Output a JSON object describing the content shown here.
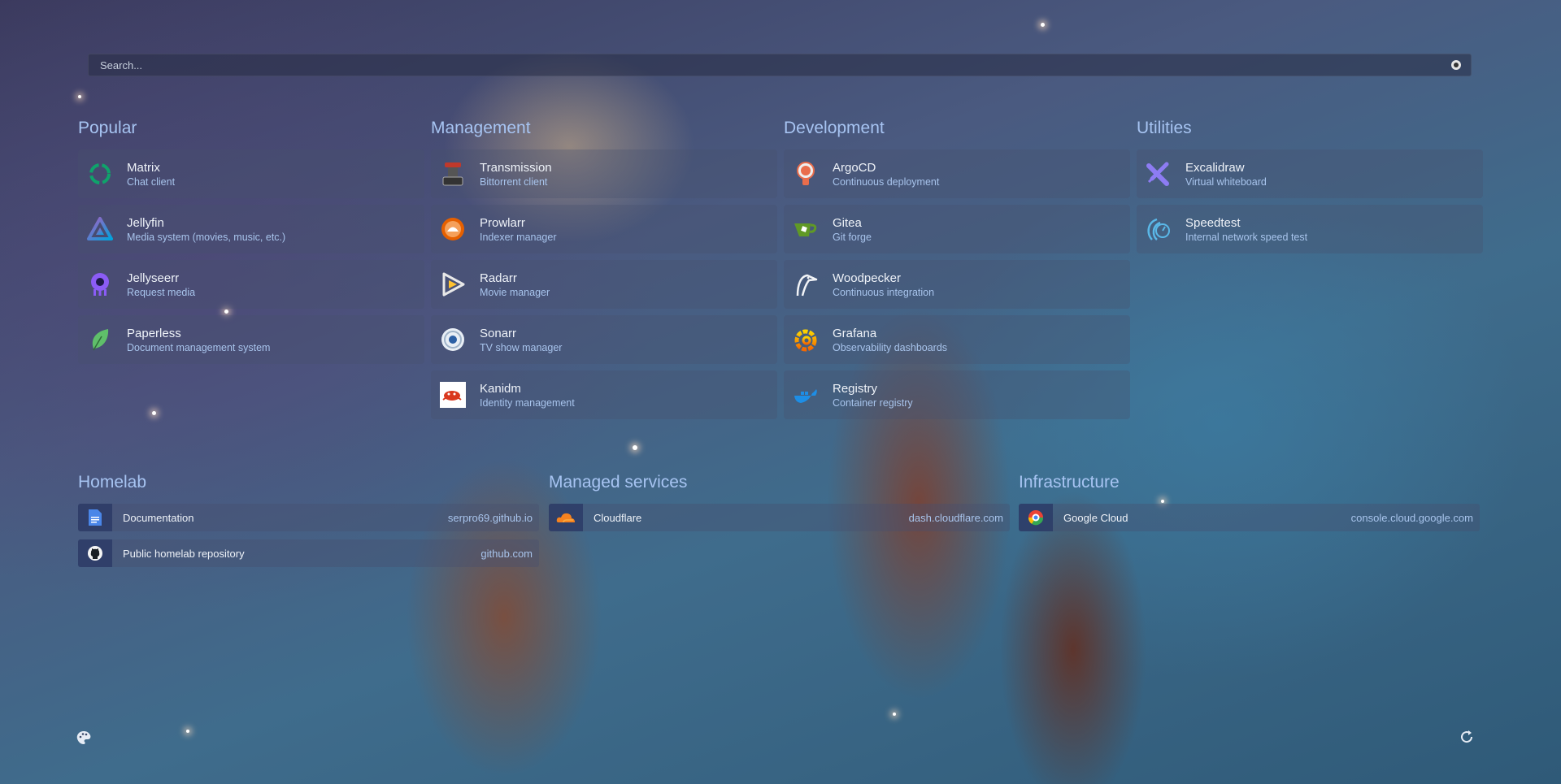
{
  "search": {
    "placeholder": "Search..."
  },
  "groups": [
    {
      "title": "Popular",
      "items": [
        {
          "name": "Matrix",
          "desc": "Chat client",
          "icon": "matrix-icon"
        },
        {
          "name": "Jellyfin",
          "desc": "Media system (movies, music, etc.)",
          "icon": "jellyfin-icon"
        },
        {
          "name": "Jellyseerr",
          "desc": "Request media",
          "icon": "jellyseerr-icon"
        },
        {
          "name": "Paperless",
          "desc": "Document management system",
          "icon": "paperless-icon"
        }
      ]
    },
    {
      "title": "Management",
      "items": [
        {
          "name": "Transmission",
          "desc": "Bittorrent client",
          "icon": "transmission-icon"
        },
        {
          "name": "Prowlarr",
          "desc": "Indexer manager",
          "icon": "prowlarr-icon"
        },
        {
          "name": "Radarr",
          "desc": "Movie manager",
          "icon": "radarr-icon"
        },
        {
          "name": "Sonarr",
          "desc": "TV show manager",
          "icon": "sonarr-icon"
        },
        {
          "name": "Kanidm",
          "desc": "Identity management",
          "icon": "kanidm-icon"
        }
      ]
    },
    {
      "title": "Development",
      "items": [
        {
          "name": "ArgoCD",
          "desc": "Continuous deployment",
          "icon": "argocd-icon"
        },
        {
          "name": "Gitea",
          "desc": "Git forge",
          "icon": "gitea-icon"
        },
        {
          "name": "Woodpecker",
          "desc": "Continuous integration",
          "icon": "woodpecker-icon"
        },
        {
          "name": "Grafana",
          "desc": "Observability dashboards",
          "icon": "grafana-icon"
        },
        {
          "name": "Registry",
          "desc": "Container registry",
          "icon": "docker-registry-icon"
        }
      ]
    },
    {
      "title": "Utilities",
      "items": [
        {
          "name": "Excalidraw",
          "desc": "Virtual whiteboard",
          "icon": "excalidraw-icon"
        },
        {
          "name": "Speedtest",
          "desc": "Internal network speed test",
          "icon": "speedtest-icon"
        }
      ]
    }
  ],
  "bookmark_groups": [
    {
      "title": "Homelab",
      "items": [
        {
          "label": "Documentation",
          "url": "serpro69.github.io",
          "icon": "document-icon"
        },
        {
          "label": "Public homelab repository",
          "url": "github.com",
          "icon": "github-icon"
        }
      ]
    },
    {
      "title": "Managed services",
      "items": [
        {
          "label": "Cloudflare",
          "url": "dash.cloudflare.com",
          "icon": "cloudflare-icon"
        }
      ]
    },
    {
      "title": "Infrastructure",
      "items": [
        {
          "label": "Google Cloud",
          "url": "console.cloud.google.com",
          "icon": "google-cloud-icon"
        }
      ]
    }
  ],
  "footer": {
    "left_icon": "palette-icon",
    "right_icon": "refresh-icon"
  },
  "colors": {
    "accent": "#a7c4f2",
    "description": "#a8c4ec",
    "card_bg": "rgba(70,80,110,0.32)"
  }
}
